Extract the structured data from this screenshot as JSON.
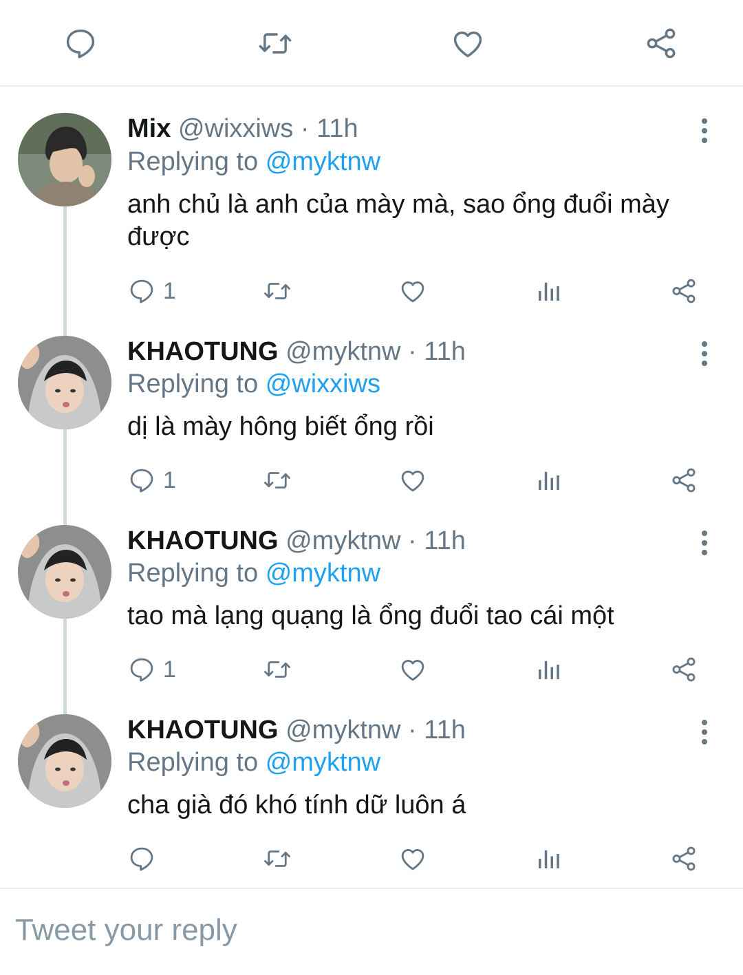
{
  "top_actions": [
    {
      "icon": "comment-icon"
    },
    {
      "icon": "retweet-icon"
    },
    {
      "icon": "heart-icon"
    },
    {
      "icon": "share-icon"
    }
  ],
  "colors": {
    "icon_gray": "#657786",
    "text_dark": "#14171a",
    "link_blue": "#1da1f2",
    "divider": "#e6ecf0",
    "thread_line": "#cfd9de"
  },
  "tweets": [
    {
      "name": "Mix",
      "handle": "@wixxiws",
      "separator": "·",
      "time": "11h",
      "replying_label": "Replying to",
      "replying_to": "@myktnw",
      "text": "anh chủ là anh của mày mà, sao ổng đuổi mày được",
      "reply_count": "1",
      "avatar": "mix-avatar"
    },
    {
      "name": "KHAOTUNG",
      "handle": "@myktnw",
      "separator": "·",
      "time": "11h",
      "replying_label": "Replying to",
      "replying_to": "@wixxiws",
      "text": "dị là mày hông biết ổng rồi",
      "reply_count": "1",
      "avatar": "khaotung-avatar"
    },
    {
      "name": "KHAOTUNG",
      "handle": "@myktnw",
      "separator": "·",
      "time": "11h",
      "replying_label": "Replying to",
      "replying_to": "@myktnw",
      "text": "tao mà lạng quạng là ổng đuổi tao cái một",
      "reply_count": "1",
      "avatar": "khaotung-avatar"
    },
    {
      "name": "KHAOTUNG",
      "handle": "@myktnw",
      "separator": "·",
      "time": "11h",
      "replying_label": "Replying to",
      "replying_to": "@myktnw",
      "text": "cha già đó khó tính dữ luôn á",
      "reply_count": "",
      "avatar": "khaotung-avatar"
    }
  ],
  "composer": {
    "placeholder": "Tweet your reply"
  }
}
